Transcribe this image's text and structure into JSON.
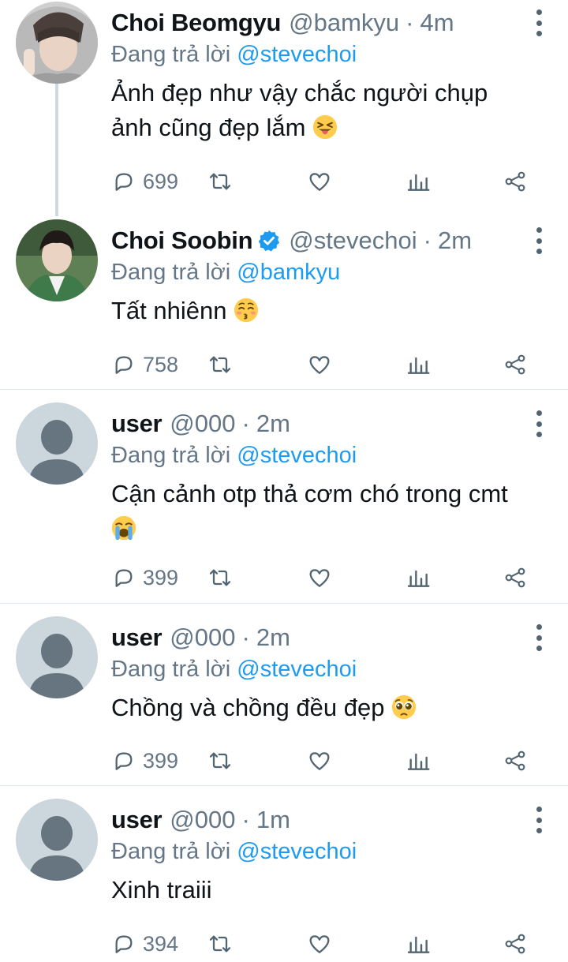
{
  "tweets": [
    {
      "name": "Choi Beomgyu",
      "verified": false,
      "handle": "@bamkyu",
      "time": "4m",
      "reply_prefix": "Đang trả lời",
      "reply_to": "@stevechoi",
      "text_line1": "Ảnh đẹp như vậy chắc người chụp",
      "text_line2": "ảnh cũng đẹp lắm",
      "emoji": "squinting-face-with-tongue",
      "reply_count": "699"
    },
    {
      "name": "Choi Soobin",
      "verified": true,
      "handle": "@stevechoi",
      "time": "2m",
      "reply_prefix": "Đang trả lời",
      "reply_to": "@bamkyu",
      "text_line1": "Tất nhiênn",
      "emoji": "kissing-face-with-smiling-eyes",
      "reply_count": "758"
    },
    {
      "name": "user",
      "verified": false,
      "handle": "@000",
      "time": "2m",
      "reply_prefix": "Đang trả lời",
      "reply_to": "@stevechoi",
      "text_line1": "Cận cảnh otp thả cơm chó trong cmt",
      "emoji": "loudly-crying-face",
      "reply_count": "399"
    },
    {
      "name": "user",
      "verified": false,
      "handle": "@000",
      "time": "2m",
      "reply_prefix": "Đang trả lời",
      "reply_to": "@stevechoi",
      "text_line1": "Chồng và chồng đều đẹp",
      "emoji": "pleading-face",
      "reply_count": "399"
    },
    {
      "name": "user",
      "verified": false,
      "handle": "@000",
      "time": "1m",
      "reply_prefix": "Đang trả lời",
      "reply_to": "@stevechoi",
      "text_line1": "Xinh traiii",
      "reply_count": "394"
    }
  ],
  "icons": {
    "reply": "reply-bubble-icon",
    "retweet": "retweet-icon",
    "like": "heart-icon",
    "analytics": "analytics-bars-icon",
    "share": "share-icon",
    "more": "more-vertical-icon"
  },
  "colors": {
    "mention": "#1d9bf0",
    "secondary_text": "#657786",
    "verified": "#1d9bf0",
    "separator": "#e1e8ed"
  }
}
